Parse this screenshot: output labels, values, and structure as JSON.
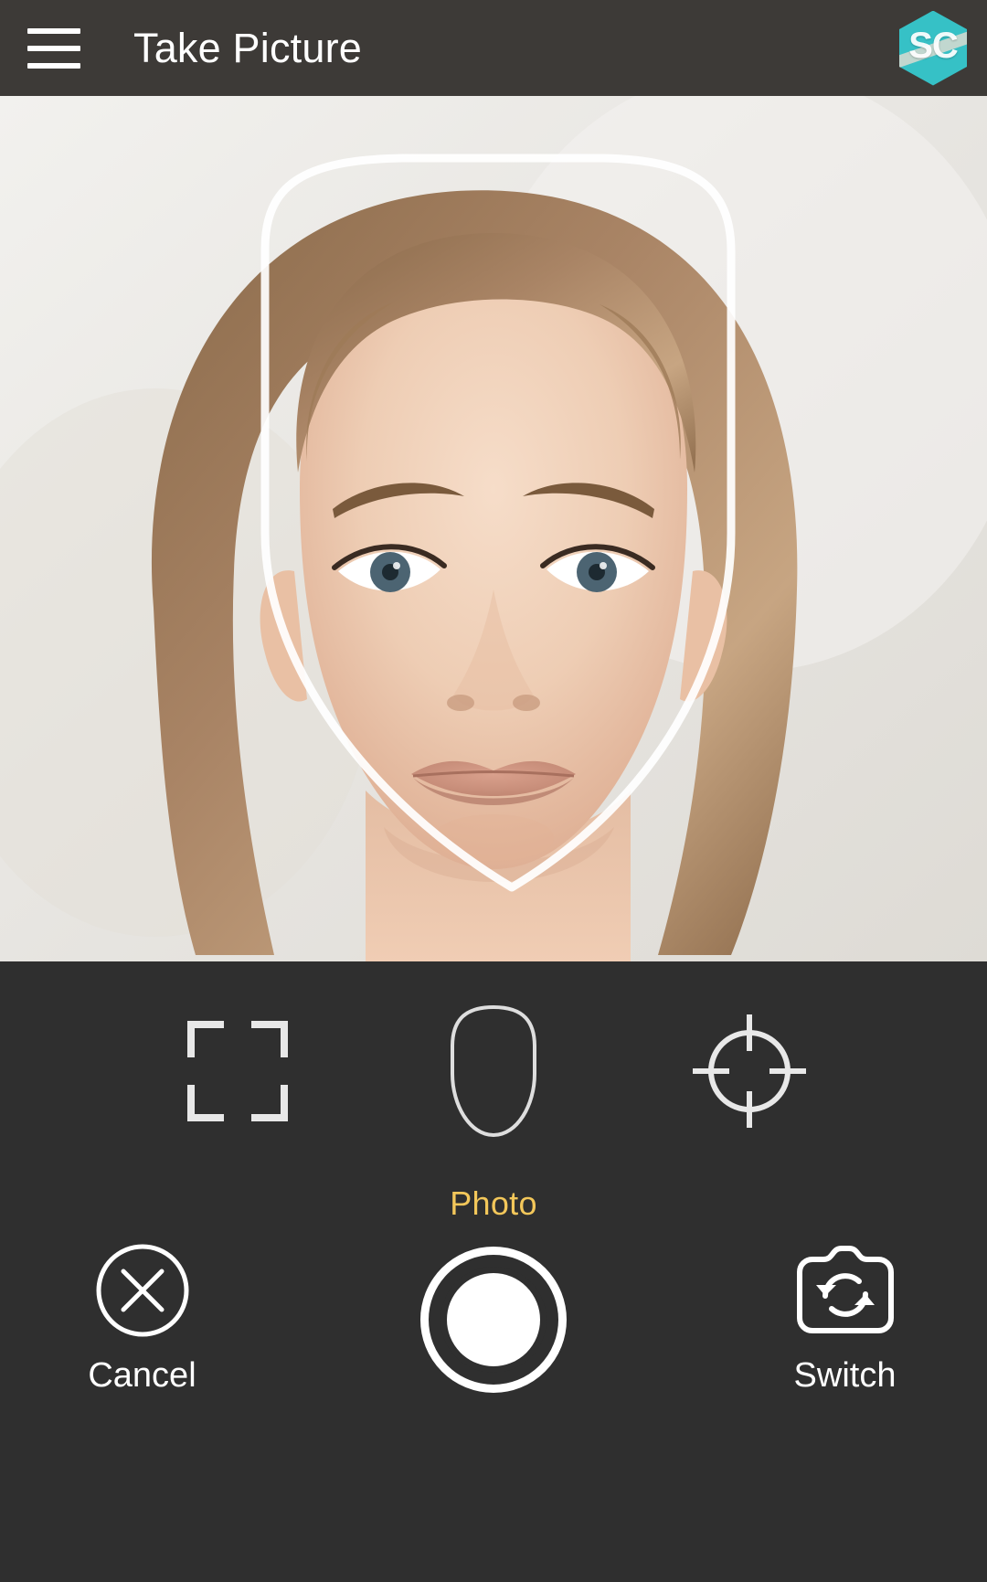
{
  "appbar": {
    "menu_icon": "hamburger-menu-icon",
    "title": "Take Picture",
    "logo_text": "SC",
    "logo_icon": "app-logo-hexagon-icon",
    "bg_color": "#3d3a37",
    "title_color": "#ffffff"
  },
  "preview": {
    "overlay_guide": "face-outline-guide",
    "subject": "portrait of a woman facing the camera",
    "guide_color": "#ffffff"
  },
  "controls": {
    "bg_color": "#2f2f2f",
    "modes": [
      {
        "name": "crop-frame-mode",
        "icon": "crop-frame-icon",
        "label": ""
      },
      {
        "name": "face-outline-mode",
        "icon": "face-oval-icon",
        "label": ""
      },
      {
        "name": "target-focus-mode",
        "icon": "crosshair-target-icon",
        "label": ""
      }
    ],
    "mode_label": "Photo",
    "mode_label_color": "#f3c75a",
    "cancel": {
      "label": "Cancel",
      "icon": "close-circle-icon"
    },
    "shutter": {
      "label": "",
      "icon": "shutter-button-icon"
    },
    "switch": {
      "label": "Switch",
      "icon": "switch-camera-icon"
    }
  }
}
